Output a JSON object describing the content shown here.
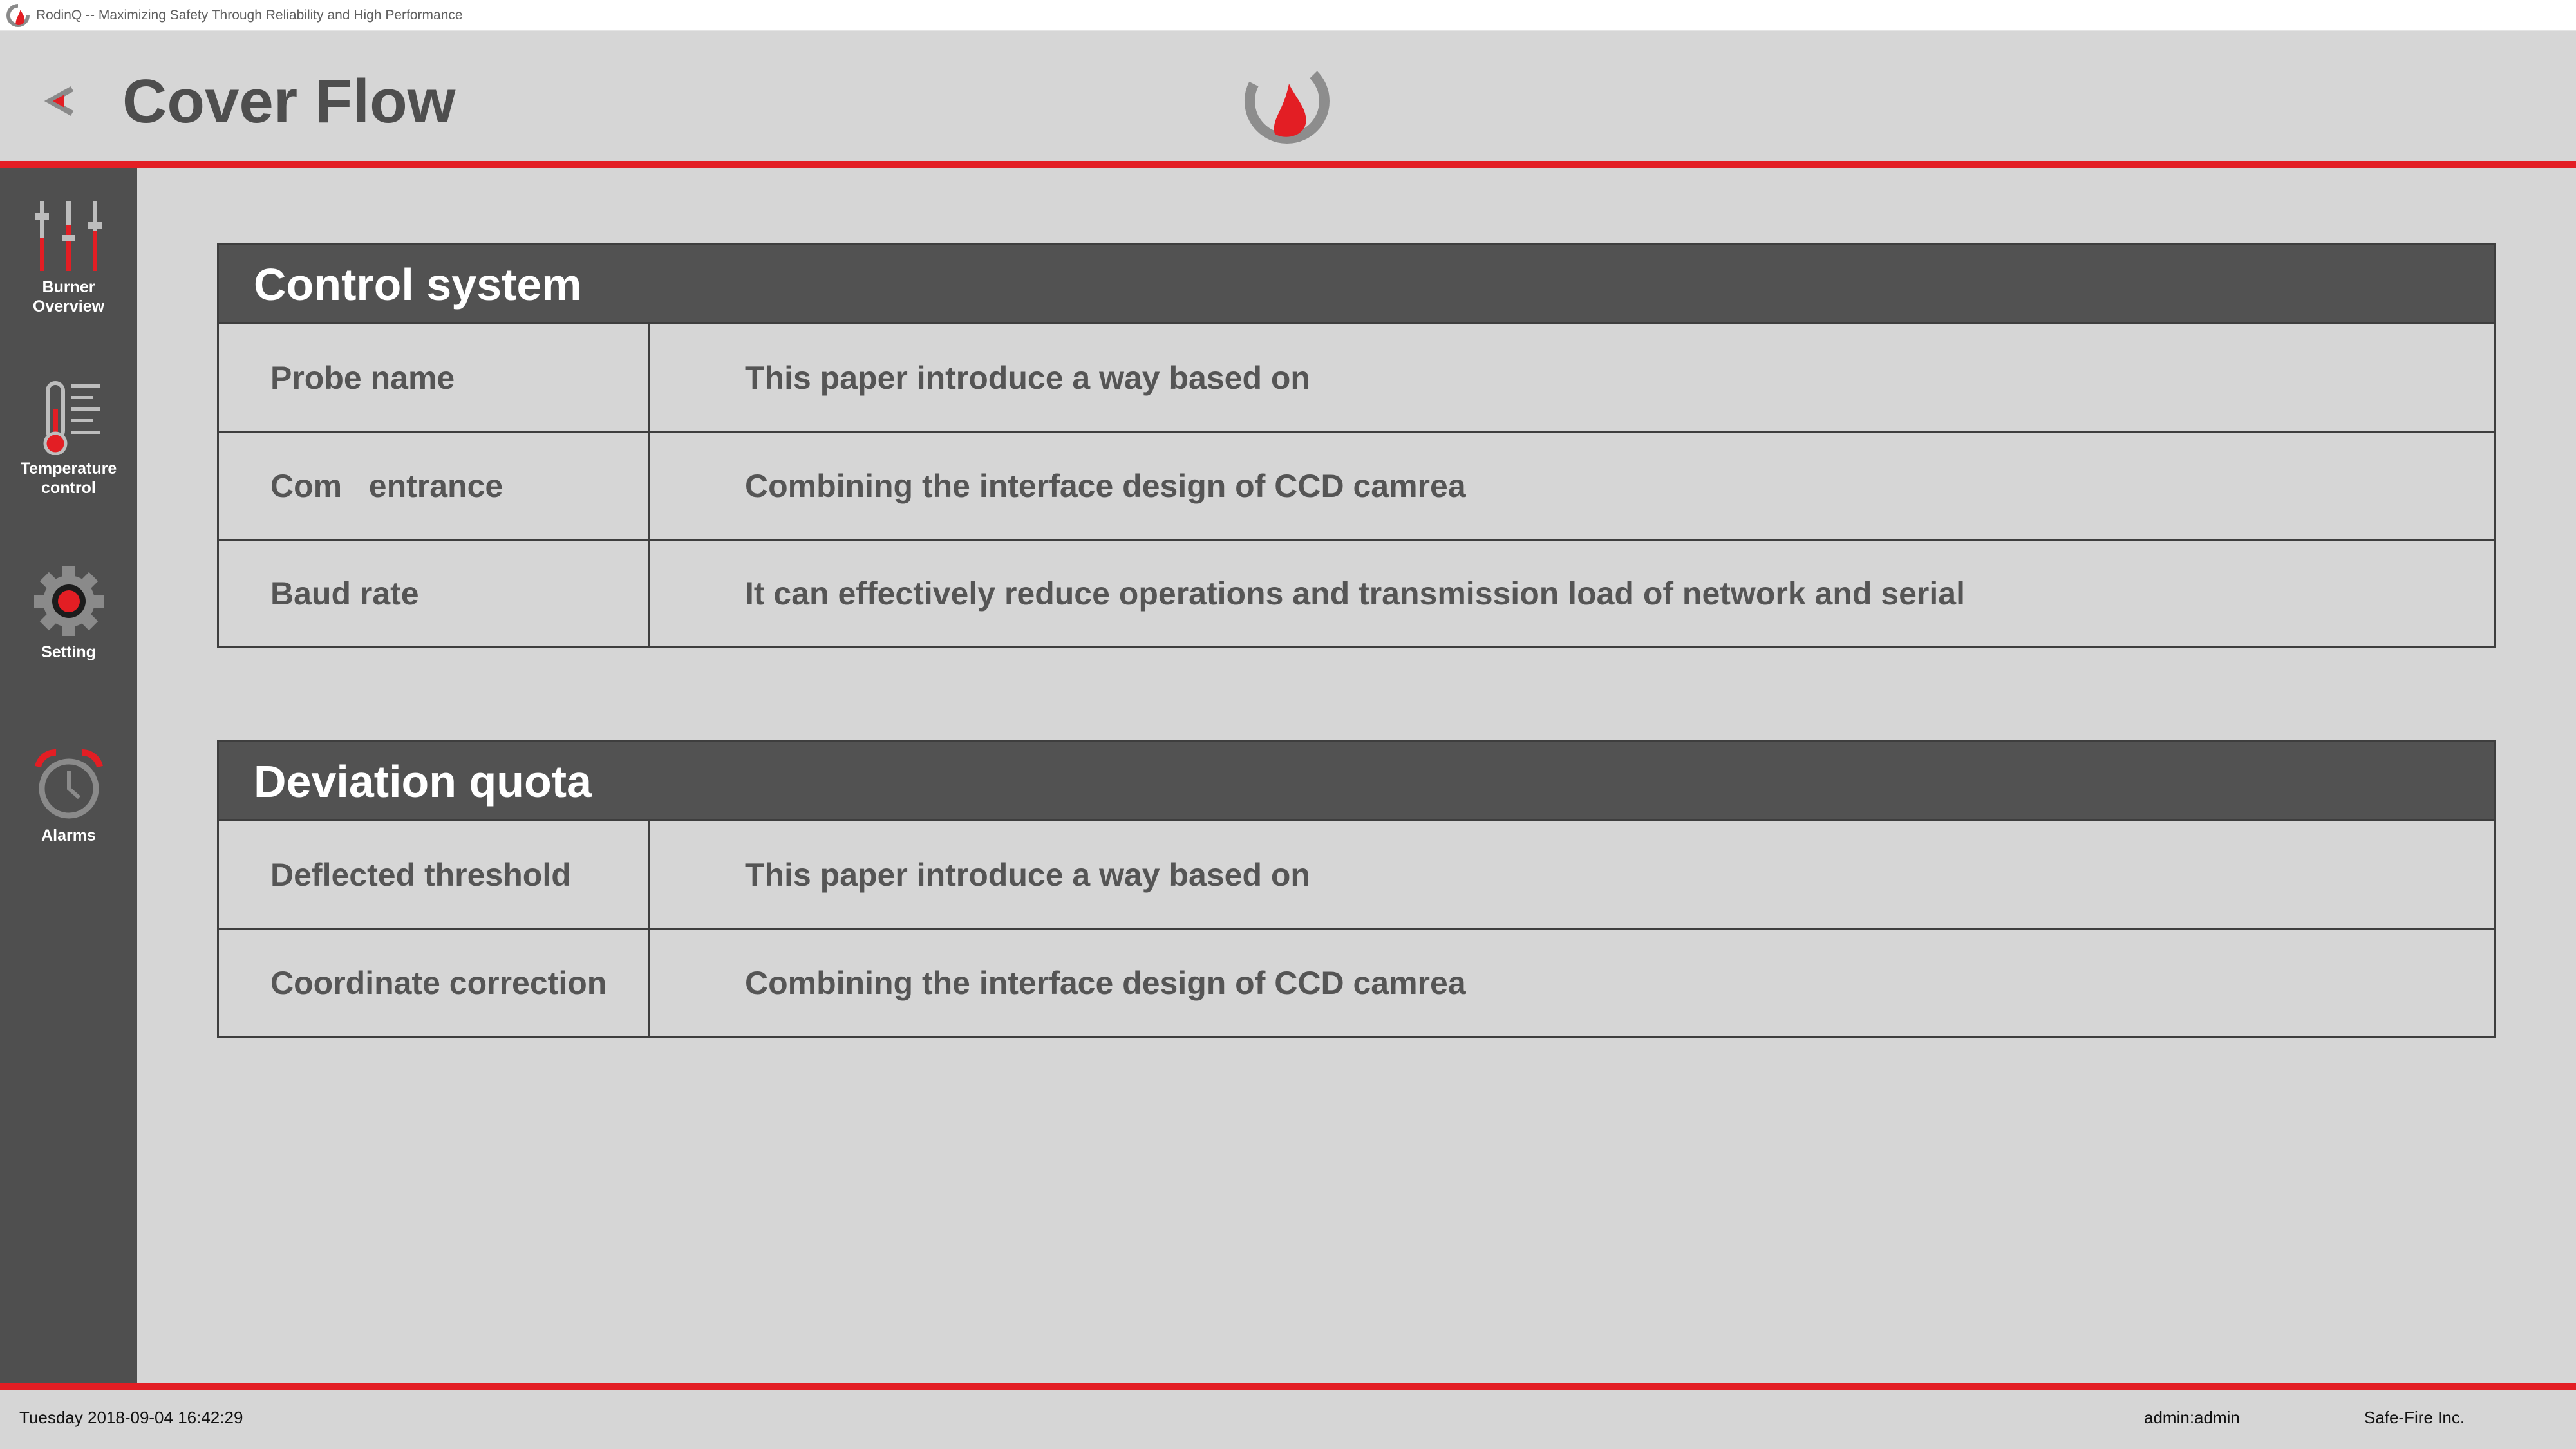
{
  "window": {
    "title": "RodinQ -- Maximizing Safety Through Reliability and High Performance"
  },
  "header": {
    "title": "Cover Flow",
    "back_icon": "back-arrow-icon",
    "logo_icon": "rodinq-logo"
  },
  "sidebar": {
    "items": [
      {
        "label": "Burner\nOverview",
        "icon": "sliders-icon"
      },
      {
        "label": "Temperature\ncontrol",
        "icon": "thermometer-icon"
      },
      {
        "label": "Setting",
        "icon": "gear-icon"
      },
      {
        "label": "Alarms",
        "icon": "alarm-clock-icon"
      }
    ]
  },
  "sections": [
    {
      "title": "Control system",
      "rows": [
        {
          "label": "Probe name",
          "value": "This paper introduce a way based on"
        },
        {
          "label": "Com   entrance",
          "value": "Combining the interface design of CCD camrea"
        },
        {
          "label": "Baud rate",
          "value": "It can effectively reduce operations and transmission load of network and serial"
        }
      ]
    },
    {
      "title": "Deviation quota",
      "rows": [
        {
          "label": "Deflected threshold",
          "value": "This paper introduce a way based on"
        },
        {
          "label": "Coordinate correction",
          "value": "Combining the interface design of CCD camrea"
        }
      ]
    }
  ],
  "status": {
    "datetime": "Tuesday 2018-09-04 16:42:29",
    "user": "admin:admin",
    "company": "Safe-Fire Inc."
  },
  "colors": {
    "accent": "#e31e24",
    "sidebar": "#4f4f4f",
    "panel_header": "#525252",
    "background": "#d6d6d6"
  }
}
